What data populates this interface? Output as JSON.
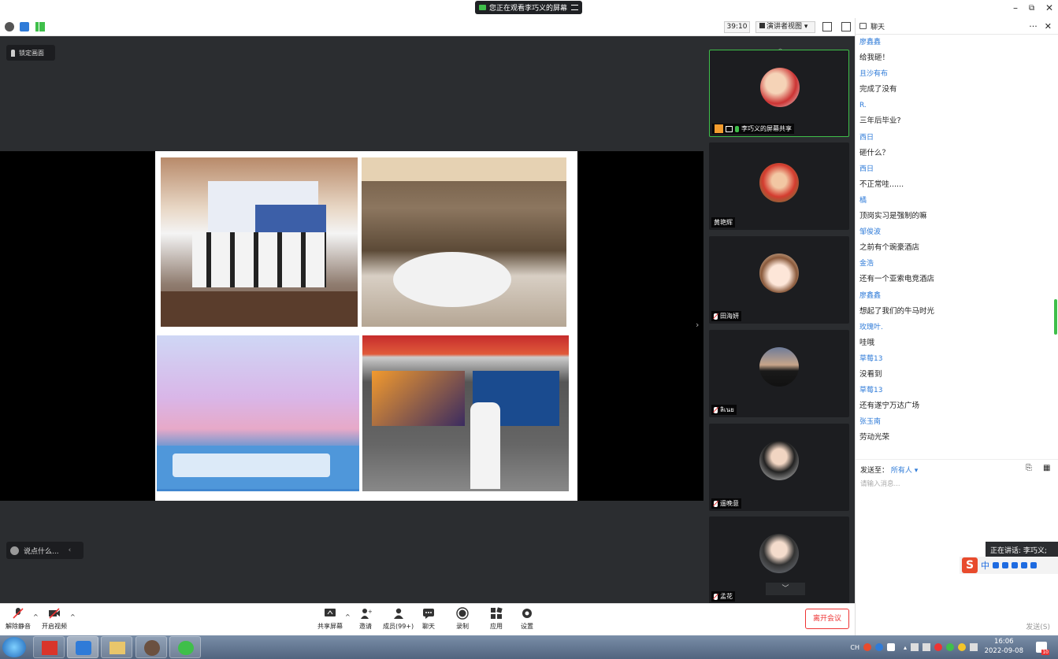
{
  "topbar": {
    "share_status": "您正在观看李巧义的屏幕"
  },
  "toolbar": {
    "timer": "39:10",
    "view_mode": "演讲者视图"
  },
  "main": {
    "lock_label": "锁定画面",
    "say_placeholder": "说点什么..."
  },
  "participants": [
    {
      "name": "李巧义的屏幕共享",
      "active": true
    },
    {
      "name": "黄艳辉",
      "active": false
    },
    {
      "name": "田海妍",
      "active": false
    },
    {
      "name": "ลิเนย",
      "active": false
    },
    {
      "name": "遥晚意",
      "active": false
    },
    {
      "name": "孟花",
      "active": false
    }
  ],
  "chat": {
    "title": "聊天",
    "messages": [
      {
        "who": "廖鑫鑫",
        "text": "给我砸！"
      },
      {
        "who": "且沙有布",
        "text": "完成了没有"
      },
      {
        "who": "R.",
        "text": "三年后毕业?"
      },
      {
        "who": "西日",
        "text": "砸什么？"
      },
      {
        "who": "西日",
        "text": "不正常哇......"
      },
      {
        "who": "橘",
        "text": "顶岗实习是强制的嘛"
      },
      {
        "who": "邹俊波",
        "text": "之前有个豌豪酒店"
      },
      {
        "who": "金浩",
        "text": "还有一个亚索电竞酒店"
      },
      {
        "who": "廖鑫鑫",
        "text": "想起了我们的牛马时光"
      },
      {
        "who": "玫瑰叶.",
        "text": "哇哦"
      },
      {
        "who": "草莓13",
        "text": "没看到"
      },
      {
        "who": "草莓13",
        "text": "还有遂宁万达广场"
      },
      {
        "who": "张玉南",
        "text": "劳动光荣"
      }
    ],
    "send_to_label": "发送至：",
    "send_to_value": "所有人",
    "input_placeholder": "请输入消息...",
    "send_button": "发送(S)"
  },
  "speaking": "正在讲话: 李巧义;",
  "ime": {
    "lang": "中"
  },
  "bottom": {
    "mute": "解除静音",
    "video": "开启视频",
    "share": "共享屏幕",
    "invite": "邀请",
    "members": "成员(99+)",
    "chat": "聊天",
    "record": "录制",
    "apps": "应用",
    "settings": "设置",
    "leave": "离开会议"
  },
  "taskbar": {
    "lang": "CH",
    "time": "16:06",
    "date": "2022-09-08",
    "notif_count": "10"
  },
  "colors": {
    "accent": "#2f7bd8",
    "active_green": "#3fbf4a",
    "leave_red": "#e33333"
  }
}
